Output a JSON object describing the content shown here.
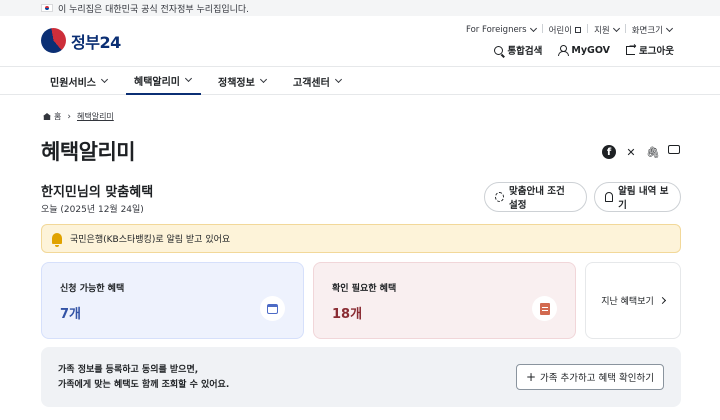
{
  "banner": {
    "text": "이 누리집은 대한민국 공식 전자정부 누리집입니다."
  },
  "header": {
    "logo_text": "정부24",
    "util": [
      "For Foreigners",
      "어린이",
      "지원",
      "화면크기"
    ],
    "actions": {
      "search": "통합검색",
      "mygov": "MyGOV",
      "logout": "로그아웃"
    }
  },
  "nav": {
    "items": [
      "민원서비스",
      "혜택알리미",
      "정책정보",
      "고객센터"
    ],
    "active": "혜택알리미"
  },
  "breadcrumb": {
    "home": "홈",
    "current": "혜택알리미"
  },
  "page": {
    "title": "혜택알리미",
    "subheading": "한지민님의 맞춤혜택",
    "date": "오늘 (2025년 12월 24일)",
    "settings_button": "맞춤안내 조건 설정",
    "history_button": "알림 내역 보기",
    "notice": "국민은행(KB스타뱅킹)로 알림 받고 있어요"
  },
  "cards": {
    "available": {
      "label": "신청 가능한 혜택",
      "value": "7개"
    },
    "check": {
      "label": "확인 필요한 혜택",
      "value": "18개"
    },
    "past": {
      "label": "지난 혜택보기"
    }
  },
  "family": {
    "line1": "가족 정보를 등록하고 동의를 받으면,",
    "line2": "가족에게 맞는 혜택도 함께 조회할 수 있어요.",
    "button": "가족 추가하고 혜택 확인하기"
  },
  "share_icons": [
    "facebook-icon",
    "x-icon",
    "link-icon",
    "print-icon"
  ],
  "colors": {
    "brand": "#0b2f74",
    "notice_bg": "#fdf3d9",
    "card_blue": "#eef2fd",
    "card_red": "#f9eff0"
  }
}
